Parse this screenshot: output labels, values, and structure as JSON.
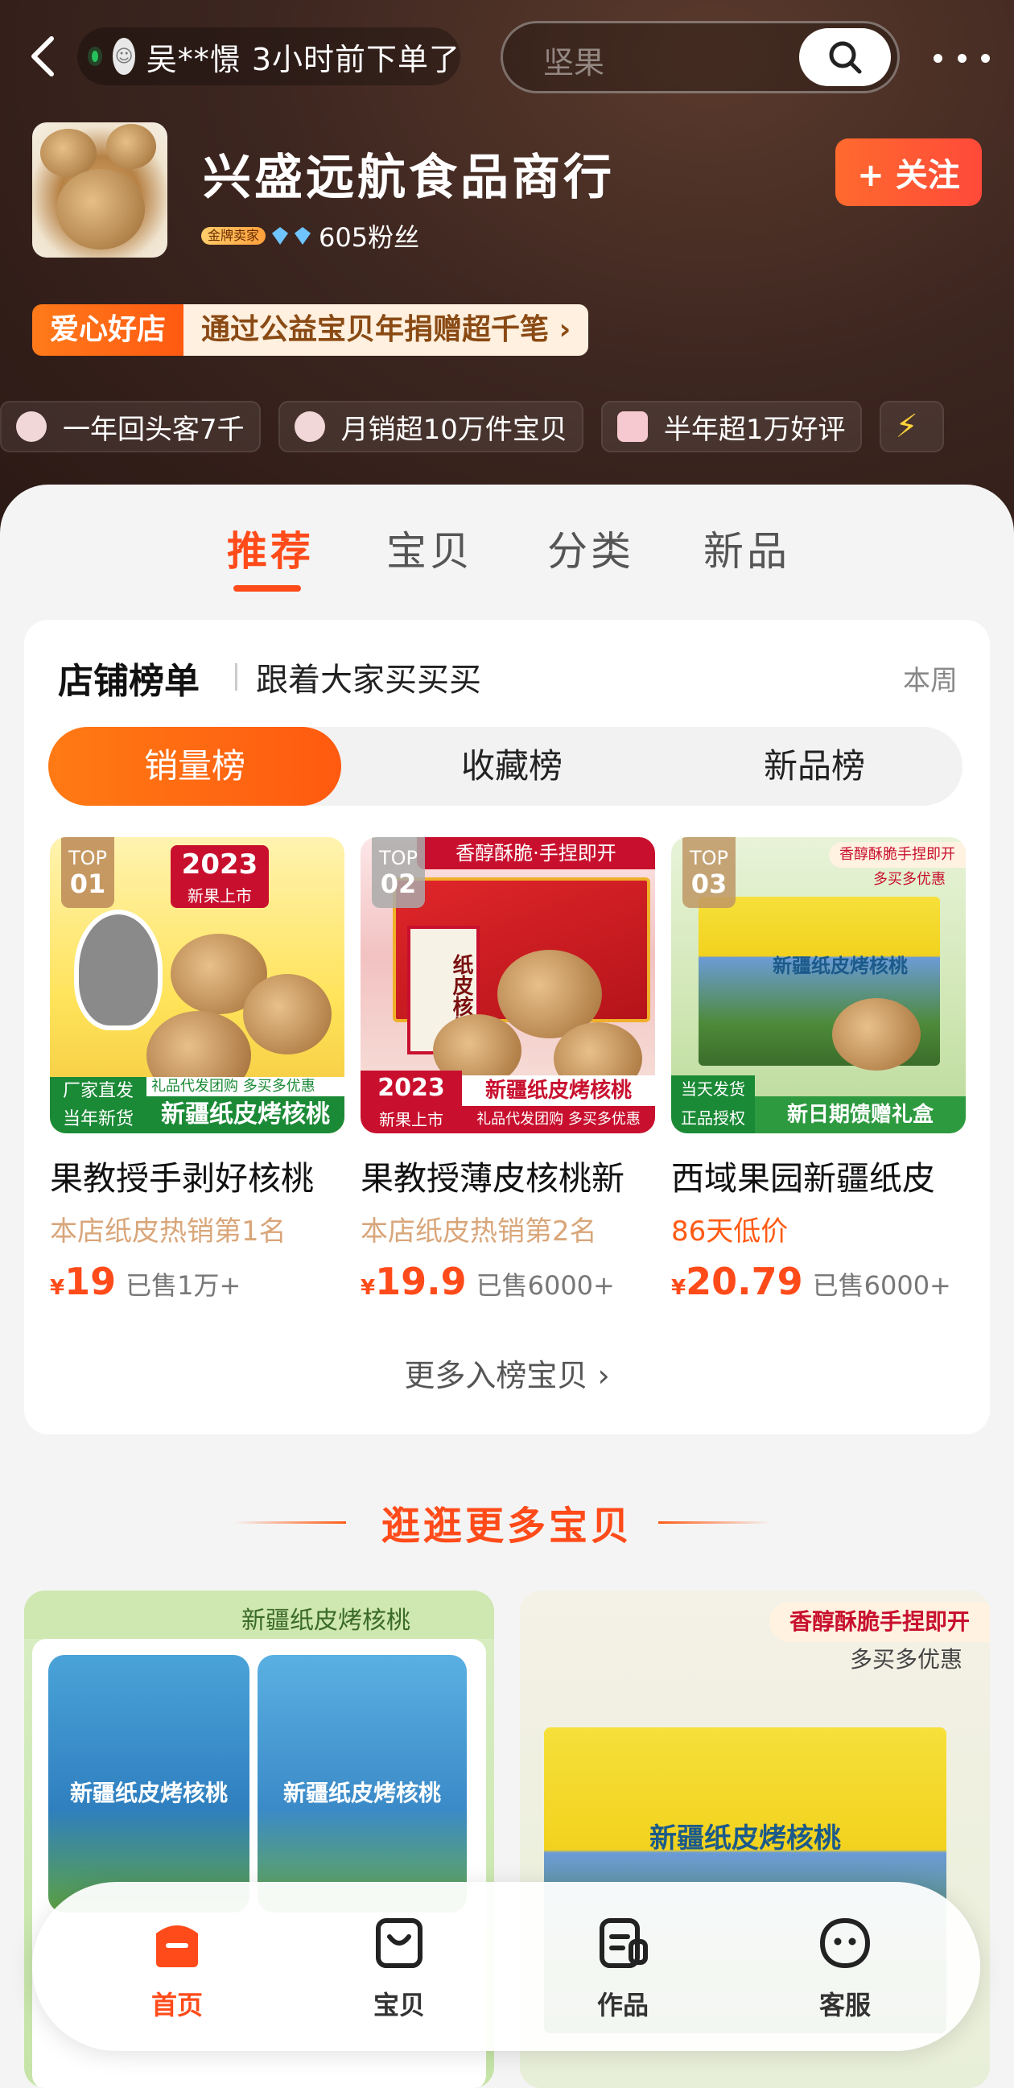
{
  "top_bar": {
    "live_text": "吴**憬 3小时前下单了",
    "search_placeholder": "坚果"
  },
  "shop": {
    "name": "兴盛远航食品商行",
    "badge": "金牌卖家",
    "fans": "605粉丝",
    "follow_label": "+ 关注",
    "charity_tag": "爱心好店",
    "charity_text": "通过公益宝贝年捐赠超千笔 ›"
  },
  "stats": [
    "一年回头客7千",
    "月销超10万件宝贝",
    "半年超1万好评"
  ],
  "tabs": [
    "推荐",
    "宝贝",
    "分类",
    "新品"
  ],
  "ranking": {
    "title": "店铺榜单",
    "subtitle": "跟着大家买买买",
    "period": "本周",
    "segments": [
      "销量榜",
      "收藏榜",
      "新品榜"
    ],
    "more_label": "更多入榜宝贝 ›",
    "products": [
      {
        "top_label": "TOP",
        "top_num": "01",
        "image_texts": [
          "2023",
          "新果上市",
          "礼品代发团购 多买多优惠",
          "厂家直发",
          "当年新货",
          "新疆纸皮烤核桃"
        ],
        "name": "果教授手剥好核桃",
        "rank_text": "本店纸皮热销第1名",
        "currency": "¥",
        "price": "19",
        "sold": "已售1万+"
      },
      {
        "top_label": "TOP",
        "top_num": "02",
        "image_texts": [
          "香醇酥脆·手捏即开",
          "纸皮核桃",
          "2023",
          "新果上市",
          "新疆纸皮烤核桃",
          "礼品代发团购 多买多优惠"
        ],
        "name": "果教授薄皮核桃新",
        "rank_text": "本店纸皮热销第2名",
        "currency": "¥",
        "price": "19.9",
        "sold": "已售6000+"
      },
      {
        "top_label": "TOP",
        "top_num": "03",
        "image_texts": [
          "香醇酥脆手捏即开",
          "多买多优惠",
          "新疆纸皮烤核桃",
          "当天发货",
          "正品授权",
          "新日期馈赠礼盒"
        ],
        "name": "西域果园新疆纸皮",
        "rank_text": "86天低价",
        "currency": "¥",
        "price": "20.79",
        "sold": "已售6000+"
      }
    ]
  },
  "more_section": {
    "title": "逛逛更多宝贝",
    "cards": [
      {
        "header": "新疆纸皮烤核桃",
        "pack_text": "新疆纸皮烤核桃"
      },
      {
        "tag1": "香醇酥脆手捏即开",
        "tag2": "多买多优惠",
        "box_text": "新疆纸皮烤核桃"
      }
    ]
  },
  "bottom_nav": [
    "首页",
    "宝贝",
    "作品",
    "客服"
  ],
  "colors": {
    "accent": "#ff4b1a",
    "hero_bg": "#3d2620"
  }
}
